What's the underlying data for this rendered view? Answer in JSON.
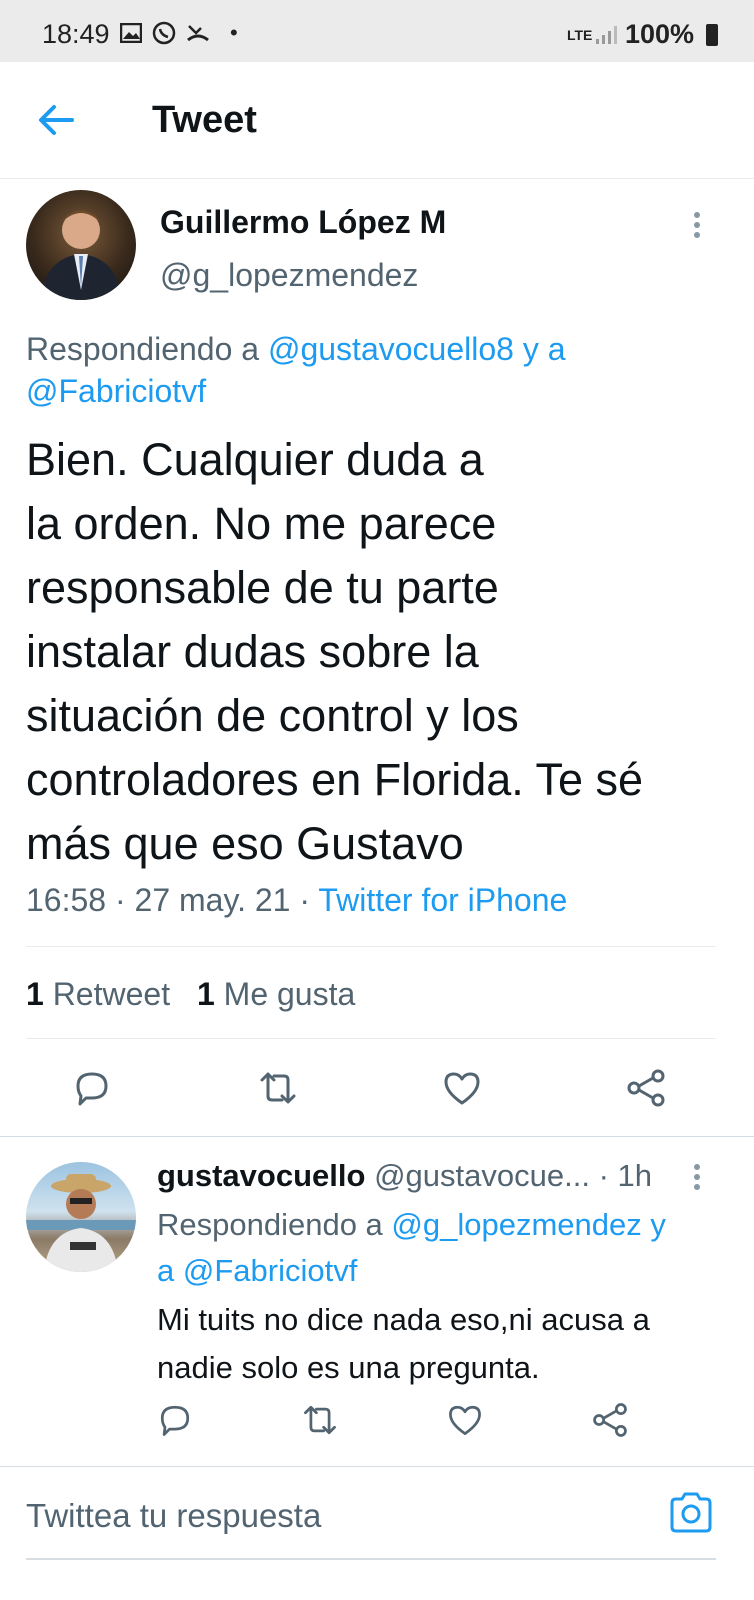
{
  "status_bar": {
    "time": "18:49",
    "dot": "•",
    "network": "LTE",
    "battery": "100%",
    "icons": [
      "image-icon",
      "whatsapp-icon",
      "missed-call-icon",
      "signal-icon",
      "battery-icon"
    ]
  },
  "header": {
    "title": "Tweet",
    "back_icon": "arrow-left-icon"
  },
  "main_tweet": {
    "author_name": "Guillermo López M",
    "handle": "@g_lopezmendez",
    "replying_prefix": "Respondiendo a ",
    "replying_user1": "@gustavocuello8",
    "replying_join": " y a",
    "replying_user2": "@Fabriciotvf",
    "text_lines": [
      "Bien. Cualquier duda a",
      "la orden. No me parece",
      "responsable de tu parte",
      "instalar dudas sobre la",
      "situación de control y los",
      "controladores en Florida. Te sé",
      "más que eso Gustavo"
    ],
    "time": "16:58",
    "separator": " · ",
    "date": "27 may. 21",
    "source": "Twitter for iPhone",
    "retweet_count": "1",
    "retweet_label": "Retweet",
    "like_count": "1",
    "like_label": "Me gusta"
  },
  "reply_tweet": {
    "author_name": "gustavocuello",
    "handle": "@gustavocue...",
    "age": "· 1h",
    "replying_prefix": "Respondiendo a ",
    "replying_user1": "@g_lopezmendez",
    "replying_join": " y",
    "replying_join2": "a ",
    "replying_user2": "@Fabriciotvf",
    "text_lines": [
      "Mi tuits no dice nada eso,ni acusa a",
      "nadie solo es una pregunta."
    ]
  },
  "reply_composer": {
    "placeholder": "Twittea tu respuesta",
    "camera_icon": "camera-icon"
  },
  "colors": {
    "accent": "#1d9bf0",
    "text": "#0f1419",
    "secondary": "#536471",
    "status_bar_bg": "#ebebeb"
  }
}
